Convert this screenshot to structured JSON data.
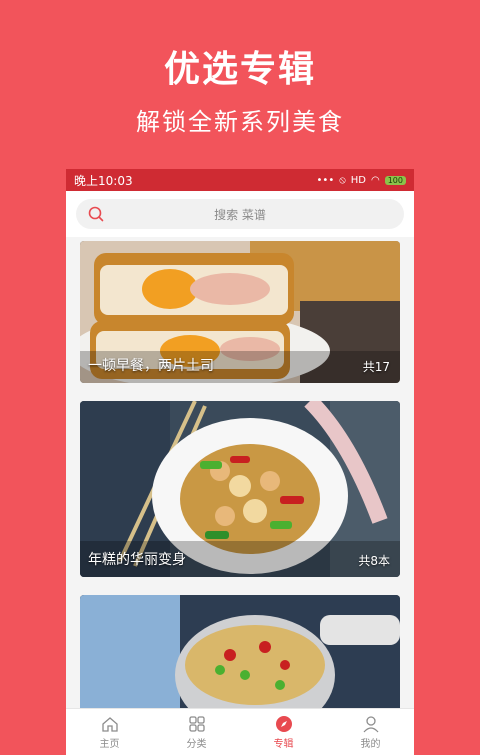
{
  "promo": {
    "title": "优选专辑",
    "subtitle": "解锁全新系列美食"
  },
  "statusbar": {
    "time": "晚上10:03",
    "signal": "HD",
    "battery": "100"
  },
  "search": {
    "placeholder": "搜索 菜谱"
  },
  "albums": [
    {
      "title": "一顿早餐，两片土司",
      "count": "共17"
    },
    {
      "title": "年糕的华丽变身",
      "count": "共8本"
    },
    {
      "title": "",
      "count": ""
    }
  ],
  "tabs": [
    {
      "label": "主页",
      "icon": "home-icon"
    },
    {
      "label": "分类",
      "icon": "grid-icon"
    },
    {
      "label": "专辑",
      "icon": "compass-icon"
    },
    {
      "label": "我的",
      "icon": "person-icon"
    }
  ],
  "colors": {
    "background": "#f2545b",
    "statusbar": "#cf2b33",
    "accent": "#e84a50"
  }
}
